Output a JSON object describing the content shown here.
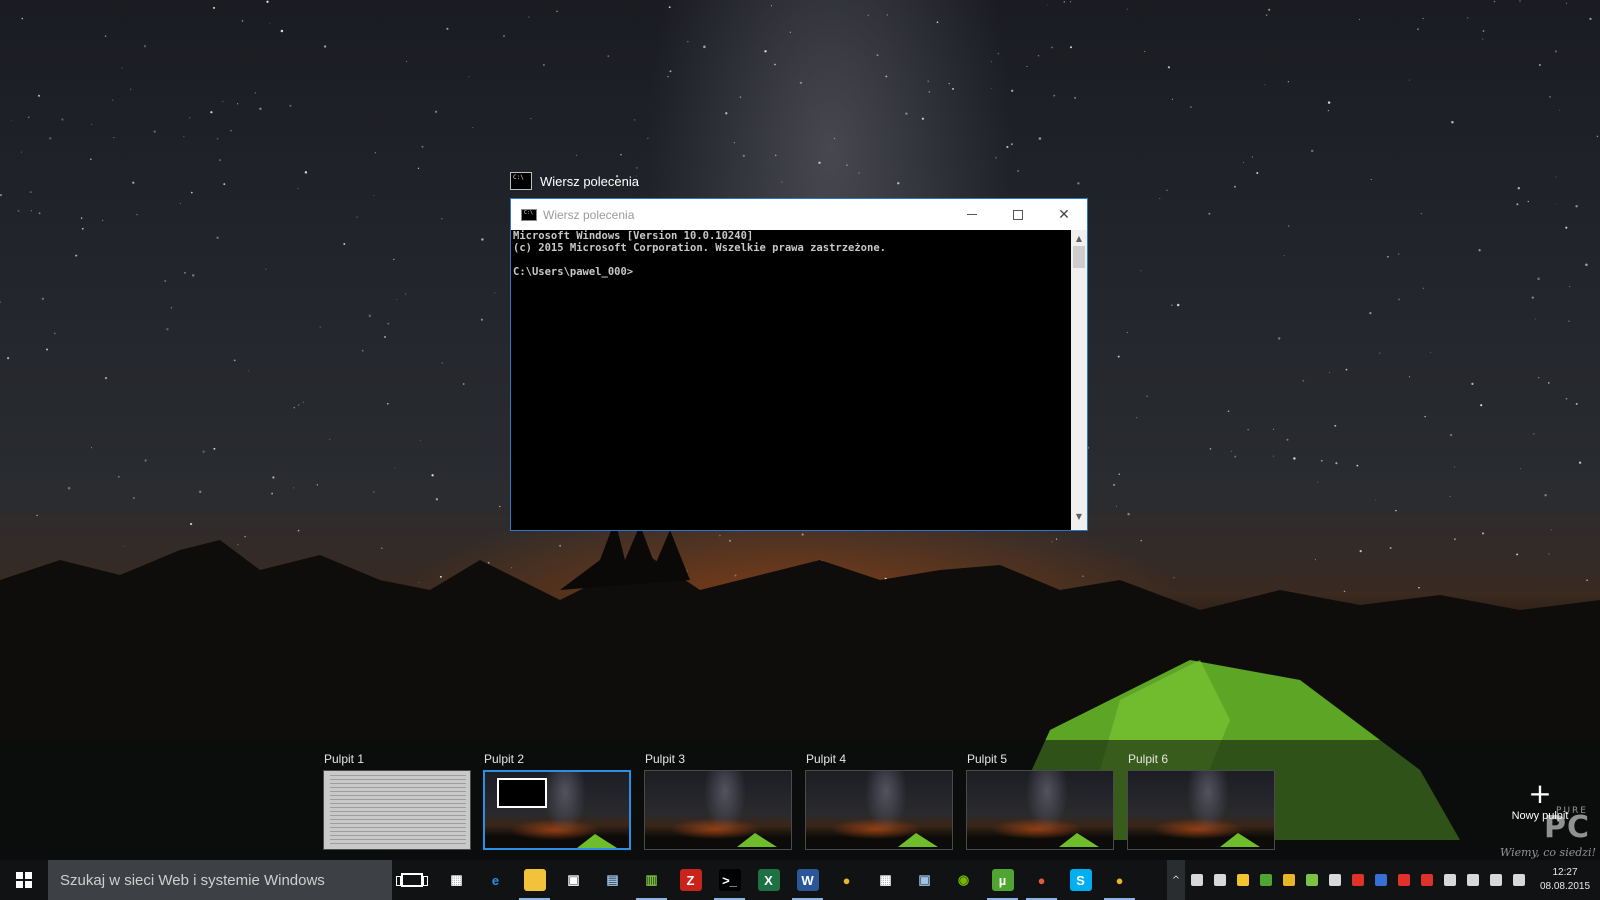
{
  "task_view": {
    "window_caption": "Wiersz polecenia",
    "cmd_window": {
      "title": "Wiersz polecenia",
      "lines": [
        "Microsoft Windows [Version 10.0.10240]",
        "(c) 2015 Microsoft Corporation. Wszelkie prawa zastrzeżone.",
        "",
        "C:\\Users\\pawel_000>"
      ],
      "min_icon": "minimize-icon",
      "max_icon": "maximize-icon",
      "close_icon": "close-icon",
      "close_glyph": "✕",
      "scroll_up_glyph": "▲",
      "scroll_down_glyph": "▼"
    },
    "desktops": [
      {
        "label": "Pulpit 1",
        "active": false
      },
      {
        "label": "Pulpit 2",
        "active": true
      },
      {
        "label": "Pulpit 3",
        "active": false
      },
      {
        "label": "Pulpit 4",
        "active": false
      },
      {
        "label": "Pulpit 5",
        "active": false
      },
      {
        "label": "Pulpit 6",
        "active": false
      }
    ],
    "new_desktop": {
      "plus": "+",
      "label": "Nowy pulpit"
    }
  },
  "watermark": {
    "logo": "PC",
    "sub": "PURE",
    "tagline": "Wiemy, co siedzi!"
  },
  "taskbar": {
    "search_placeholder": "Szukaj w sieci Web i systemie Windows",
    "pinned": [
      {
        "icon": "apps-grid-icon",
        "glyph": "▦",
        "color": "#ffffff",
        "bg": "transparent",
        "running": false
      },
      {
        "icon": "edge-icon",
        "glyph": "e",
        "color": "#2f8fe8",
        "bg": "transparent",
        "running": false
      },
      {
        "icon": "file-explorer-icon",
        "glyph": "▬",
        "color": "#f2c23a",
        "bg": "#f2c23a",
        "running": true
      },
      {
        "icon": "store-icon",
        "glyph": "▣",
        "color": "#ffffff",
        "bg": "transparent",
        "running": false
      },
      {
        "icon": "network-icon",
        "glyph": "▤",
        "color": "#9fc3e6",
        "bg": "transparent",
        "running": false
      },
      {
        "icon": "notepad-icon",
        "glyph": "▥",
        "color": "#7cc243",
        "bg": "transparent",
        "running": true
      },
      {
        "icon": "filezilla-icon",
        "glyph": "Z",
        "color": "#ffffff",
        "bg": "#c9241b",
        "running": false
      },
      {
        "icon": "cmd-icon",
        "glyph": ">_",
        "color": "#ffffff",
        "bg": "#000000",
        "running": true
      },
      {
        "icon": "excel-icon",
        "glyph": "X",
        "color": "#ffffff",
        "bg": "#1e7145",
        "running": false
      },
      {
        "icon": "word-icon",
        "glyph": "W",
        "color": "#ffffff",
        "bg": "#2b579a",
        "running": true
      },
      {
        "icon": "chrome-icon",
        "glyph": "●",
        "color": "#e9b52b",
        "bg": "transparent",
        "running": false
      },
      {
        "icon": "calendar-icon",
        "glyph": "▦",
        "color": "#ffffff",
        "bg": "transparent",
        "running": false
      },
      {
        "icon": "remote-desktop-icon",
        "glyph": "▣",
        "color": "#9fc3e6",
        "bg": "transparent",
        "running": false
      },
      {
        "icon": "nvidia-icon",
        "glyph": "◉",
        "color": "#76b900",
        "bg": "transparent",
        "running": false
      },
      {
        "icon": "utorrent-icon",
        "glyph": "µ",
        "color": "#ffffff",
        "bg": "#4fa52f",
        "running": true
      },
      {
        "icon": "chrome-profile-icon",
        "glyph": "●",
        "color": "#e35b3c",
        "bg": "transparent",
        "running": true
      },
      {
        "icon": "skype-icon",
        "glyph": "S",
        "color": "#ffffff",
        "bg": "#00aff0",
        "running": false
      },
      {
        "icon": "chrome-icon",
        "glyph": "●",
        "color": "#e9b52b",
        "bg": "transparent",
        "running": true
      }
    ],
    "tray": [
      {
        "icon": "onedrive-icon",
        "color": "#d8d8d8"
      },
      {
        "icon": "monitor-icon",
        "color": "#d8d8d8"
      },
      {
        "icon": "google-drive-icon",
        "color": "#f4c430"
      },
      {
        "icon": "utorrent-tray-icon",
        "color": "#4fa52f"
      },
      {
        "icon": "chrome-tray-icon",
        "color": "#e9b52b"
      },
      {
        "icon": "check-icon",
        "color": "#7cc243"
      },
      {
        "icon": "usb-icon",
        "color": "#d8d8d8"
      },
      {
        "icon": "minus-red-icon",
        "color": "#e0322a"
      },
      {
        "icon": "security-icon",
        "color": "#3a6fd8"
      },
      {
        "icon": "red-app-icon",
        "color": "#e0322a"
      },
      {
        "icon": "record-icon",
        "color": "#e0322a"
      },
      {
        "icon": "battery-icon",
        "color": "#d8d8d8"
      },
      {
        "icon": "wifi-icon",
        "color": "#d8d8d8"
      },
      {
        "icon": "volume-icon",
        "color": "#d8d8d8"
      },
      {
        "icon": "notifications-icon",
        "color": "#d8d8d8"
      }
    ],
    "tray_up_glyph": "^",
    "clock_time": "12:27",
    "clock_date": "08.08.2015"
  }
}
